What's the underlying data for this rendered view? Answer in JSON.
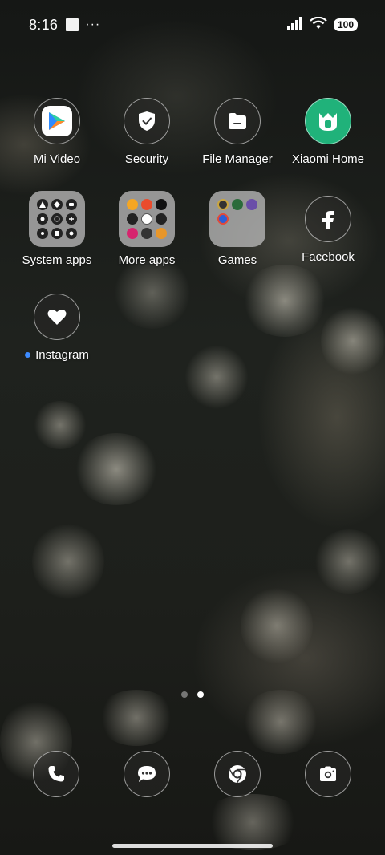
{
  "status_bar": {
    "time": "8:16",
    "overflow": "···",
    "battery": "100"
  },
  "apps": [
    {
      "label": "Mi Video",
      "icon": "mi-video-play-icon"
    },
    {
      "label": "Security",
      "icon": "shield-check-icon"
    },
    {
      "label": "File Manager",
      "icon": "folder-icon"
    },
    {
      "label": "Xiaomi Home",
      "icon": "xiaomi-home-icon"
    },
    {
      "label": "System apps",
      "icon": "folder-grid-icon"
    },
    {
      "label": "More apps",
      "icon": "folder-grid-icon"
    },
    {
      "label": "Games",
      "icon": "folder-grid-icon"
    },
    {
      "label": "Facebook",
      "icon": "facebook-f-icon"
    },
    {
      "label": "Instagram",
      "icon": "heart-icon",
      "new_badge": true
    }
  ],
  "page_indicator": {
    "count": 2,
    "current": 2
  },
  "dock": [
    {
      "name": "phone",
      "icon": "phone-icon"
    },
    {
      "name": "messages",
      "icon": "chat-bubble-icon"
    },
    {
      "name": "chrome",
      "icon": "chrome-icon"
    },
    {
      "name": "camera",
      "icon": "camera-icon"
    }
  ],
  "colors": {
    "notification_dot": "#3d8bff",
    "xiaomi_home_green": "#20b27a",
    "folder_bg": "#b9b9b9"
  }
}
